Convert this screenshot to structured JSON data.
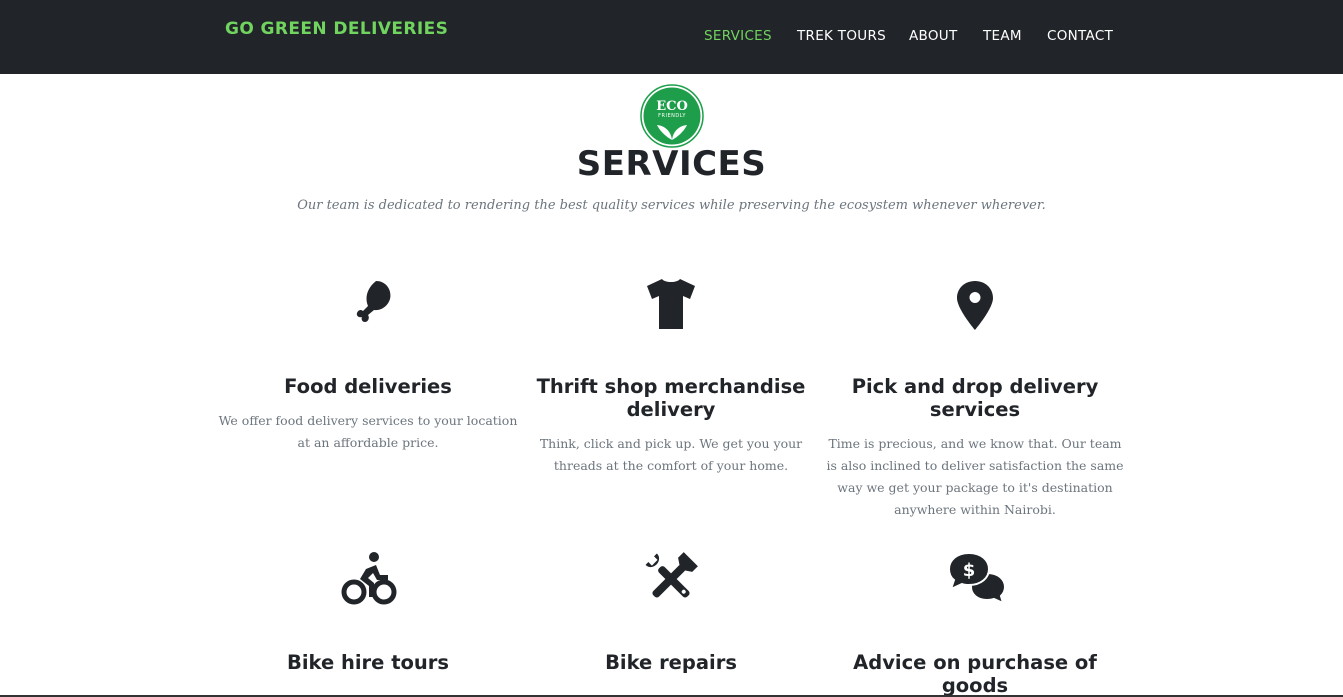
{
  "brand": "GO GREEN DELIVERIES",
  "nav": [
    {
      "label": "SERVICES",
      "active": true
    },
    {
      "label": "TREK TOURS",
      "active": false
    },
    {
      "label": "ABOUT",
      "active": false
    },
    {
      "label": "TEAM",
      "active": false
    },
    {
      "label": "CONTACT",
      "active": false
    }
  ],
  "badge": {
    "line1": "ECO",
    "line2": "FRIENDLY"
  },
  "section": {
    "title": "SERVICES",
    "subtitle": "Our team is dedicated to rendering the best quality services while preserving the ecosystem whenever wherever."
  },
  "services": [
    {
      "icon": "drumstick-icon",
      "title": "Food deliveries",
      "text": "We offer food delivery services to your location at an affordable price."
    },
    {
      "icon": "tshirt-icon",
      "title": "Thrift shop merchandise delivery",
      "text": "Think, click and pick up. We get you your threads at the comfort of your home."
    },
    {
      "icon": "map-marker-icon",
      "title": "Pick and drop delivery services",
      "text": "Time is precious, and we know that. Our team is also inclined to deliver satisfaction the same way we get your package to it's destination anywhere within Nairobi."
    },
    {
      "icon": "biking-icon",
      "title": "Bike hire tours",
      "text": ""
    },
    {
      "icon": "tools-icon",
      "title": "Bike repairs",
      "text": ""
    },
    {
      "icon": "comments-dollar-icon",
      "title": "Advice on purchase of goods",
      "text": ""
    }
  ],
  "colors": {
    "navbar": "#212529",
    "accent": "#70d45f",
    "badge": "#1e9e4a",
    "text": "#212529",
    "muted": "#6c757d"
  }
}
